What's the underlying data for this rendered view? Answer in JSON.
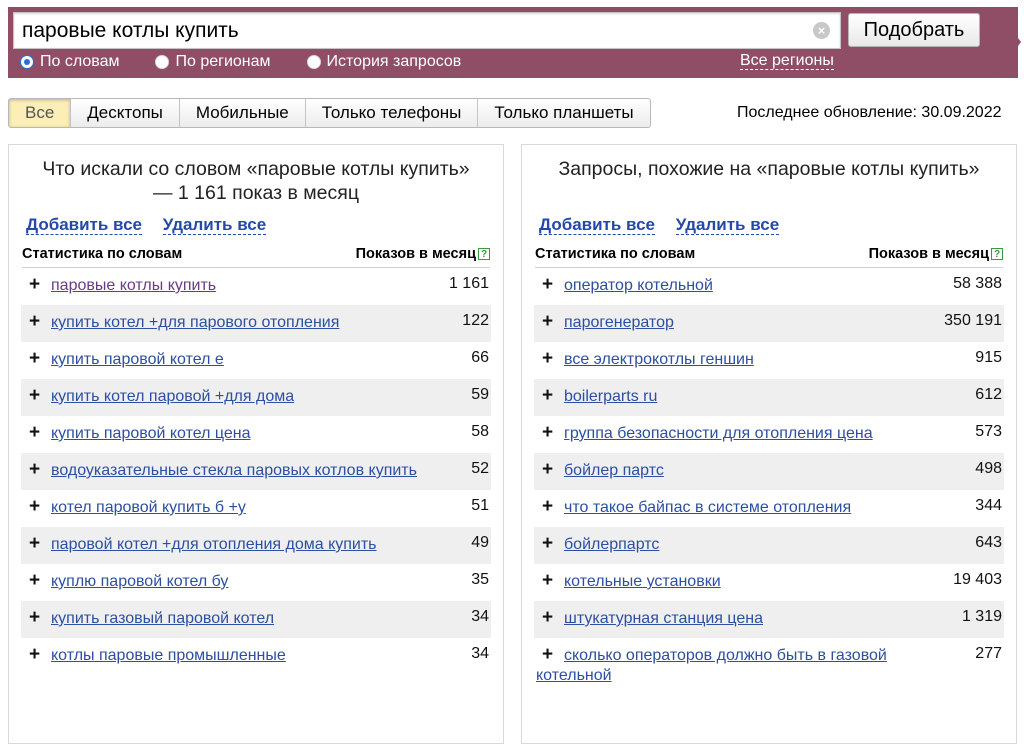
{
  "search": {
    "query": "паровые котлы купить",
    "submit_label": "Подобрать",
    "radios": [
      {
        "label": "По словам",
        "checked": true
      },
      {
        "label": "По регионам",
        "checked": false
      },
      {
        "label": "История запросов",
        "checked": false
      }
    ],
    "regions_label": "Все регионы"
  },
  "device_tabs": [
    "Все",
    "Десктопы",
    "Мобильные",
    "Только телефоны",
    "Только планшеты"
  ],
  "last_update": "Последнее обновление: 30.09.2022",
  "left_panel": {
    "title": "Что искали со словом «паровые котлы купить» — 1 161 показ в месяц",
    "add_all": "Добавить все",
    "remove_all": "Удалить все",
    "col_left": "Статистика по словам",
    "col_right": "Показов в месяц",
    "rows": [
      {
        "phrase": "паровые котлы купить",
        "count": "1 161",
        "visited": true
      },
      {
        "phrase": "купить котел +для парового отопления",
        "count": "122"
      },
      {
        "phrase": "купить паровой котел е",
        "count": "66"
      },
      {
        "phrase": "купить котел паровой +для дома",
        "count": "59"
      },
      {
        "phrase": "купить паровой котел цена",
        "count": "58"
      },
      {
        "phrase": "водоуказательные стекла паровых котлов купить",
        "count": "52"
      },
      {
        "phrase": "котел паровой купить б +у",
        "count": "51"
      },
      {
        "phrase": "паровой котел +для отопления дома купить",
        "count": "49"
      },
      {
        "phrase": "куплю паровой котел бу",
        "count": "35"
      },
      {
        "phrase": "купить газовый паровой котел",
        "count": "34"
      },
      {
        "phrase": "котлы паровые промышленные",
        "count": "34"
      }
    ]
  },
  "right_panel": {
    "title": "Запросы, похожие на «паровые котлы купить»",
    "add_all": "Добавить все",
    "remove_all": "Удалить все",
    "col_left": "Статистика по словам",
    "col_right": "Показов в месяц",
    "rows": [
      {
        "phrase": "оператор котельной",
        "count": "58 388"
      },
      {
        "phrase": "парогенератор",
        "count": "350 191"
      },
      {
        "phrase": "все электрокотлы геншин",
        "count": "915"
      },
      {
        "phrase": "boilerparts ru",
        "count": "612"
      },
      {
        "phrase": "группа безопасности для отопления цена",
        "count": "573"
      },
      {
        "phrase": "бойлер партс",
        "count": "498"
      },
      {
        "phrase": "что такое байпас в системе отопления",
        "count": "344"
      },
      {
        "phrase": "бойлерпартс",
        "count": "643"
      },
      {
        "phrase": "котельные установки",
        "count": "19 403"
      },
      {
        "phrase": "штукатурная станция цена",
        "count": "1 319"
      },
      {
        "phrase": "сколько операторов должно быть в газовой котельной",
        "count": "277"
      }
    ]
  }
}
